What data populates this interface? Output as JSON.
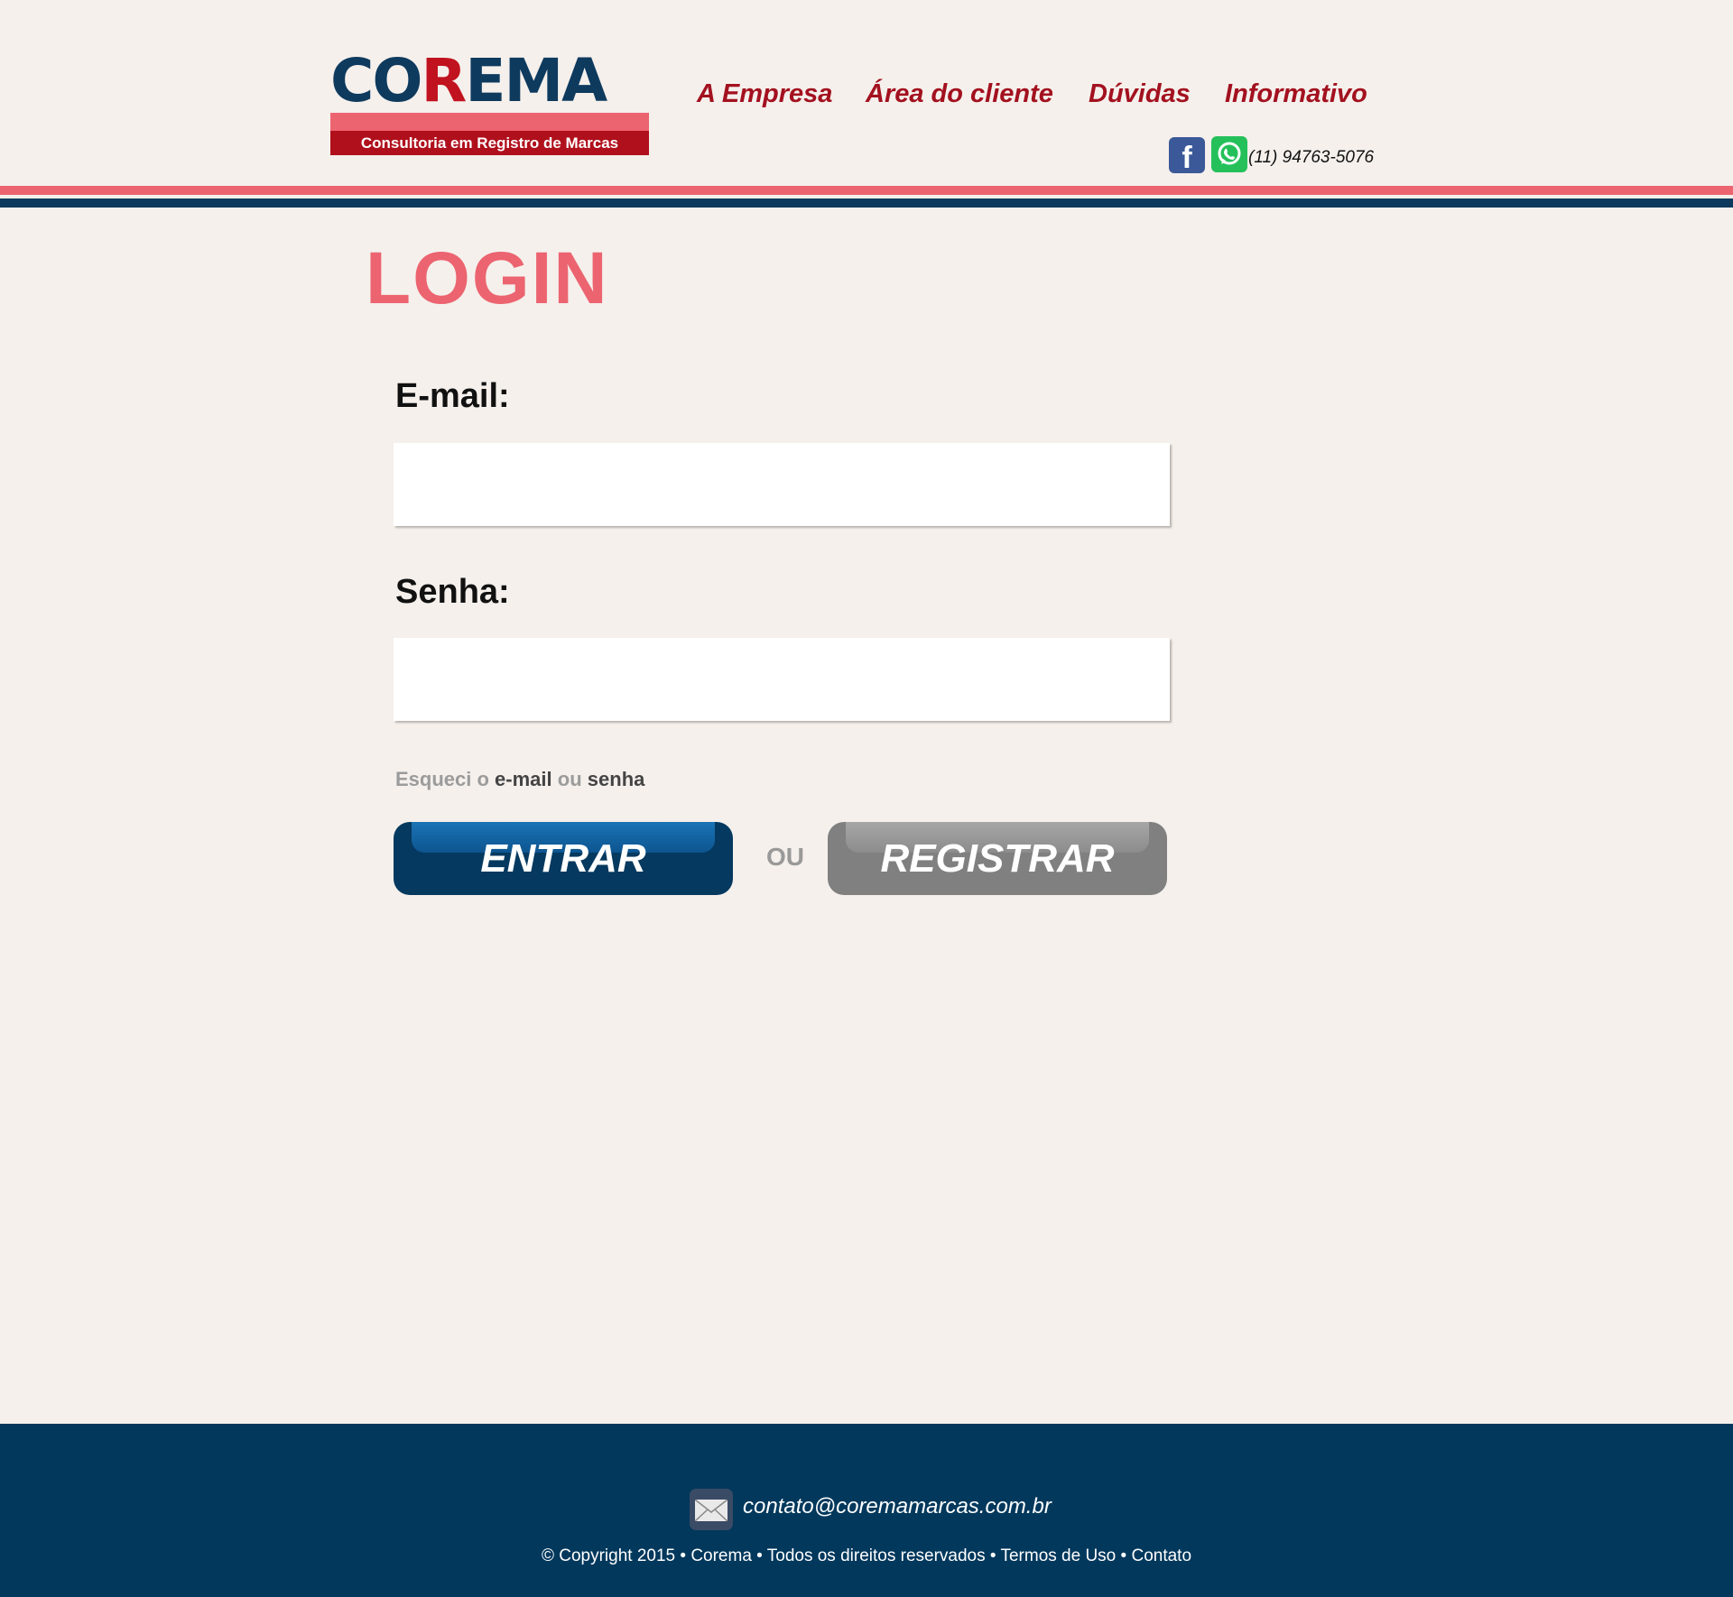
{
  "brand": {
    "logo_part1": "CO",
    "logo_r": "R",
    "logo_part2": "EMA",
    "tagline": "Consultoria em Registro de Marcas",
    "colors": {
      "navy": "#0e3a5e",
      "red": "#a3111f",
      "pink": "#ec6470",
      "footer": "#01385c"
    }
  },
  "nav": {
    "items": [
      "A Empresa",
      "Área do cliente",
      "Dúvidas",
      "Informativo"
    ]
  },
  "contact_bar": {
    "facebook_icon": "facebook-icon",
    "whatsapp_icon": "whatsapp-icon",
    "phone": "(11) 94763-5076"
  },
  "login": {
    "title": "LOGIN",
    "email_label": "E-mail:",
    "email_value": "",
    "password_label": "Senha:",
    "password_value": "",
    "forgot_prefix": "Esqueci o",
    "forgot_email": "e-mail",
    "forgot_or": "ou",
    "forgot_password": "senha",
    "enter_button": "ENTRAR",
    "or_text": "OU",
    "register_button": "REGISTRAR"
  },
  "footer": {
    "mail_icon": "mail-icon",
    "email": "contato@coremamarcas.com.br",
    "copyright": "© Copyright 2015",
    "company": "Corema",
    "rights": "Todos os direitos reservados",
    "terms": "Termos de Uso",
    "contact": "Contato",
    "separator": " • "
  }
}
